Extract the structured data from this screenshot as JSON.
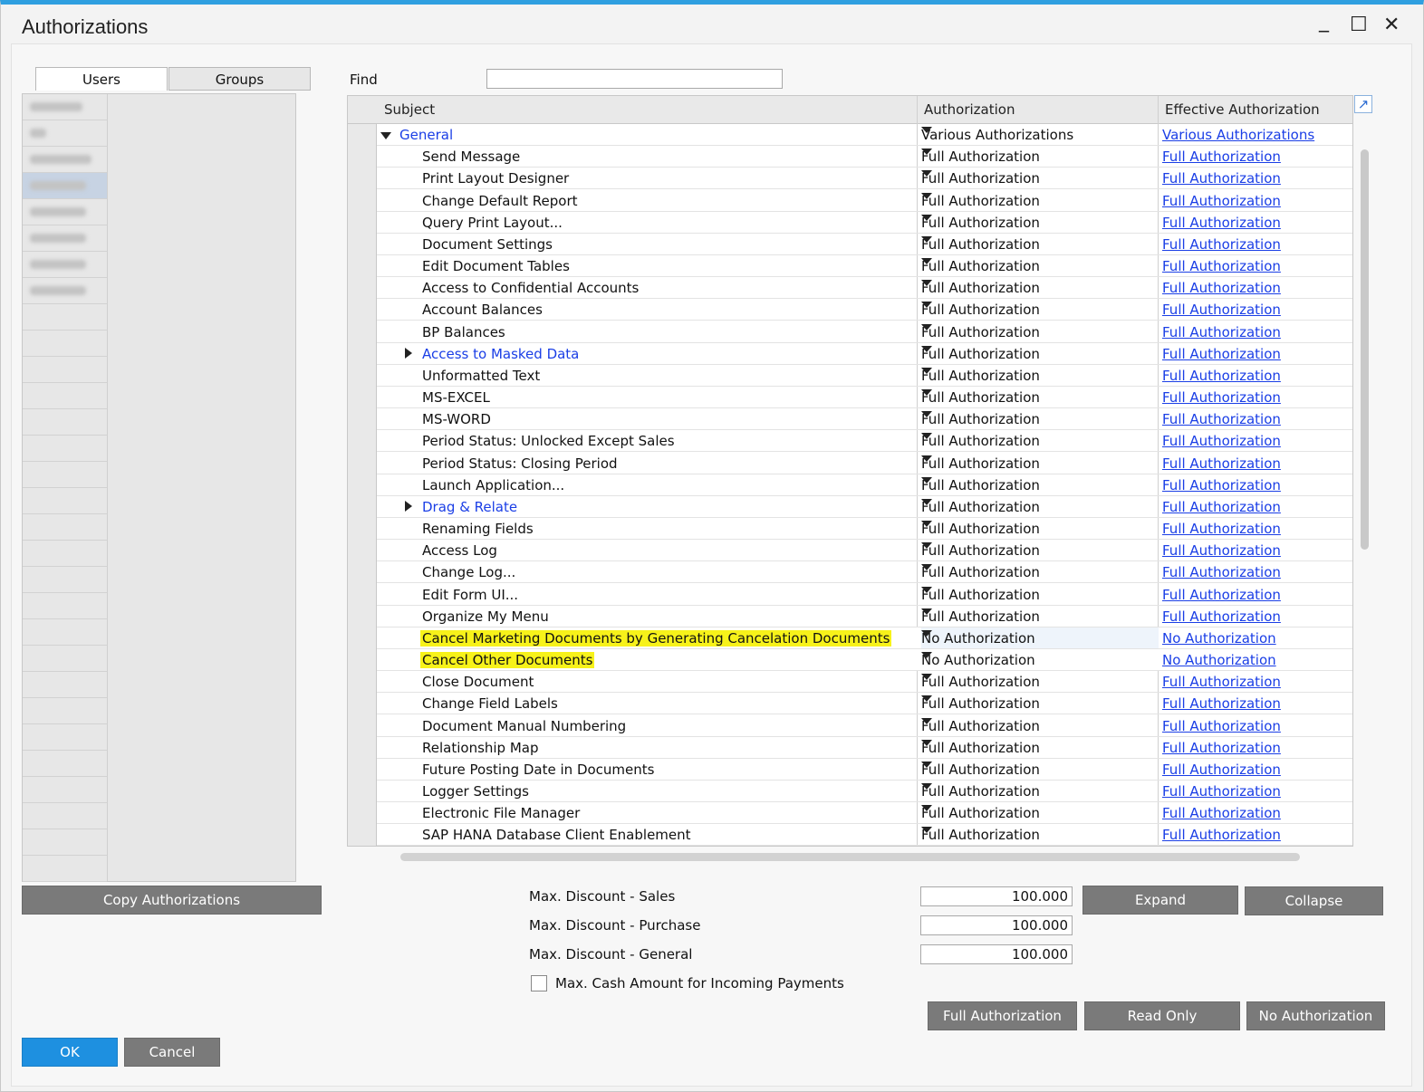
{
  "window": {
    "title": "Authorizations"
  },
  "tabs": {
    "users": "Users",
    "groups": "Groups"
  },
  "find": {
    "label": "Find",
    "value": ""
  },
  "grid": {
    "headers": {
      "subject": "Subject",
      "authorization": "Authorization",
      "effective": "Effective Authorization"
    },
    "rows": [
      {
        "subject": "General",
        "auth": "Various Authorizations",
        "eff": "Various Authorizations",
        "kind": "group-open",
        "indent": 0
      },
      {
        "subject": "Send Message",
        "auth": "Full Authorization",
        "eff": "Full Authorization"
      },
      {
        "subject": "Print Layout Designer",
        "auth": "Full Authorization",
        "eff": "Full Authorization"
      },
      {
        "subject": "Change Default Report",
        "auth": "Full Authorization",
        "eff": "Full Authorization"
      },
      {
        "subject": "Query Print Layout...",
        "auth": "Full Authorization",
        "eff": "Full Authorization"
      },
      {
        "subject": "Document Settings",
        "auth": "Full Authorization",
        "eff": "Full Authorization"
      },
      {
        "subject": "Edit Document Tables",
        "auth": "Full Authorization",
        "eff": "Full Authorization"
      },
      {
        "subject": "Access to Confidential Accounts",
        "auth": "Full Authorization",
        "eff": "Full Authorization"
      },
      {
        "subject": "Account Balances",
        "auth": "Full Authorization",
        "eff": "Full Authorization"
      },
      {
        "subject": "BP Balances",
        "auth": "Full Authorization",
        "eff": "Full Authorization"
      },
      {
        "subject": "Access to Masked Data",
        "auth": "Full Authorization",
        "eff": "Full Authorization",
        "kind": "group-closed"
      },
      {
        "subject": "Unformatted Text",
        "auth": "Full Authorization",
        "eff": "Full Authorization"
      },
      {
        "subject": "MS-EXCEL",
        "auth": "Full Authorization",
        "eff": "Full Authorization"
      },
      {
        "subject": "MS-WORD",
        "auth": "Full Authorization",
        "eff": "Full Authorization"
      },
      {
        "subject": "Period Status: Unlocked Except Sales",
        "auth": "Full Authorization",
        "eff": "Full Authorization"
      },
      {
        "subject": "Period Status: Closing Period",
        "auth": "Full Authorization",
        "eff": "Full Authorization"
      },
      {
        "subject": "Launch Application...",
        "auth": "Full Authorization",
        "eff": "Full Authorization"
      },
      {
        "subject": "Drag & Relate",
        "auth": "Full Authorization",
        "eff": "Full Authorization",
        "kind": "group-closed"
      },
      {
        "subject": "Renaming Fields",
        "auth": "Full Authorization",
        "eff": "Full Authorization"
      },
      {
        "subject": "Access Log",
        "auth": "Full Authorization",
        "eff": "Full Authorization"
      },
      {
        "subject": "Change Log...",
        "auth": "Full Authorization",
        "eff": "Full Authorization"
      },
      {
        "subject": "Edit Form UI...",
        "auth": "Full Authorization",
        "eff": "Full Authorization"
      },
      {
        "subject": "Organize My Menu",
        "auth": "Full Authorization",
        "eff": "Full Authorization"
      },
      {
        "subject": "Cancel Marketing Documents by Generating Cancelation Documents",
        "auth": "No Authorization",
        "eff": "No Authorization",
        "highlight": true
      },
      {
        "subject": "Cancel Other Documents",
        "auth": "No Authorization",
        "eff": "No Authorization",
        "highlight": true
      },
      {
        "subject": "Close Document",
        "auth": "Full Authorization",
        "eff": "Full Authorization"
      },
      {
        "subject": "Change Field Labels",
        "auth": "Full Authorization",
        "eff": "Full Authorization"
      },
      {
        "subject": "Document Manual Numbering",
        "auth": "Full Authorization",
        "eff": "Full Authorization"
      },
      {
        "subject": "Relationship Map",
        "auth": "Full Authorization",
        "eff": "Full Authorization"
      },
      {
        "subject": "Future Posting Date in Documents",
        "auth": "Full Authorization",
        "eff": "Full Authorization"
      },
      {
        "subject": "Logger Settings",
        "auth": "Full Authorization",
        "eff": "Full Authorization"
      },
      {
        "subject": "Electronic File Manager",
        "auth": "Full Authorization",
        "eff": "Full Authorization"
      },
      {
        "subject": "SAP HANA Database Client Enablement",
        "auth": "Full Authorization",
        "eff": "Full Authorization"
      }
    ]
  },
  "bottom": {
    "copy_auth": "Copy Authorizations",
    "max_discount_sales_label": "Max. Discount - Sales",
    "max_discount_sales_value": "100.000",
    "max_discount_purchase_label": "Max. Discount - Purchase",
    "max_discount_purchase_value": "100.000",
    "max_discount_general_label": "Max. Discount - General",
    "max_discount_general_value": "100.000",
    "max_cash_label": "Max. Cash Amount for Incoming Payments",
    "expand": "Expand",
    "collapse": "Collapse",
    "full_auth": "Full Authorization",
    "read_only": "Read Only",
    "no_auth": "No Authorization",
    "ok": "OK",
    "cancel": "Cancel"
  },
  "colors": {
    "accent": "#2f9fe0",
    "link": "#1a3ee6",
    "highlight": "#f7f21a",
    "button": "#7a7a7a",
    "ok_button": "#1e90e0"
  }
}
